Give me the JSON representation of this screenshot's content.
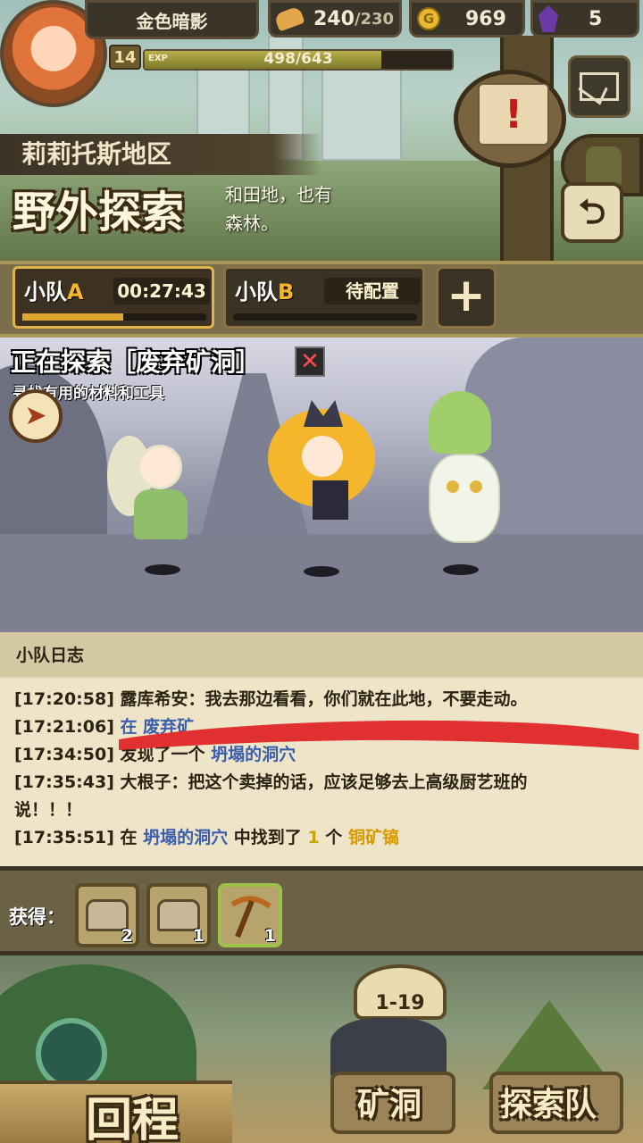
{
  "player": {
    "name": "金色暗影",
    "level": "14",
    "exp_label": "EXP",
    "exp_text": "498/643",
    "exp_fraction": 0.77
  },
  "resources": [
    {
      "icon": "bread-icon",
      "value": "240",
      "max": "/230"
    },
    {
      "icon": "gold-coin-icon",
      "value": "969"
    },
    {
      "icon": "purple-crystal-icon",
      "value": "5"
    }
  ],
  "region": {
    "name": "莉莉托斯地区",
    "mode_title": "野外探索",
    "description_line1": "和田地，也有",
    "description_line2": "森林。"
  },
  "teams": [
    {
      "label_prefix": "小队",
      "letter": "A",
      "status": "00:27:43",
      "progress": 0.55
    },
    {
      "label_prefix": "小队",
      "letter": "B",
      "status": "待配置",
      "progress": 0
    }
  ],
  "add_team_label": "+",
  "exploration": {
    "title": "正在探索［废弃矿洞］",
    "subtitle": "寻找有用的材料和工具",
    "close_label": "✕",
    "nav_glyph": "➤"
  },
  "log": {
    "header": "小队日志",
    "entries": [
      {
        "time": "[17:20:58]",
        "text": "露库希安：我去那边看看，你们就在此地，不要走动。"
      },
      {
        "time": "[17:21:06]",
        "text": "在 废弃矿"
      },
      {
        "time": "[17:34:50]",
        "pre": "发现了一个",
        "loc": "坍塌的洞穴"
      },
      {
        "time": "[17:35:43]",
        "text": "大根子：把这个卖掉的话，应该足够去上高级厨艺班的"
      },
      {
        "time": "",
        "text": "说！！！"
      },
      {
        "time": "[17:35:51]",
        "pre": "在",
        "loc": "坍塌的洞穴",
        "mid": "中找到了",
        "num": "1",
        "post": "个",
        "item": "铜矿镐"
      }
    ]
  },
  "rewards": {
    "label": "获得：",
    "items": [
      {
        "icon": "treasure-chest-icon",
        "count": "2"
      },
      {
        "icon": "treasure-chest-icon",
        "count": "1"
      },
      {
        "icon": "pickaxe-icon",
        "count": "1"
      }
    ]
  },
  "bottom": {
    "return_label": "回程",
    "level_badge": "1-19",
    "mine_label": "矿洞",
    "team_label": "探索队"
  },
  "colors": {
    "annotation_red": "#e03030",
    "gold": "#f4b62a",
    "location_blue": "#3b5fae"
  }
}
